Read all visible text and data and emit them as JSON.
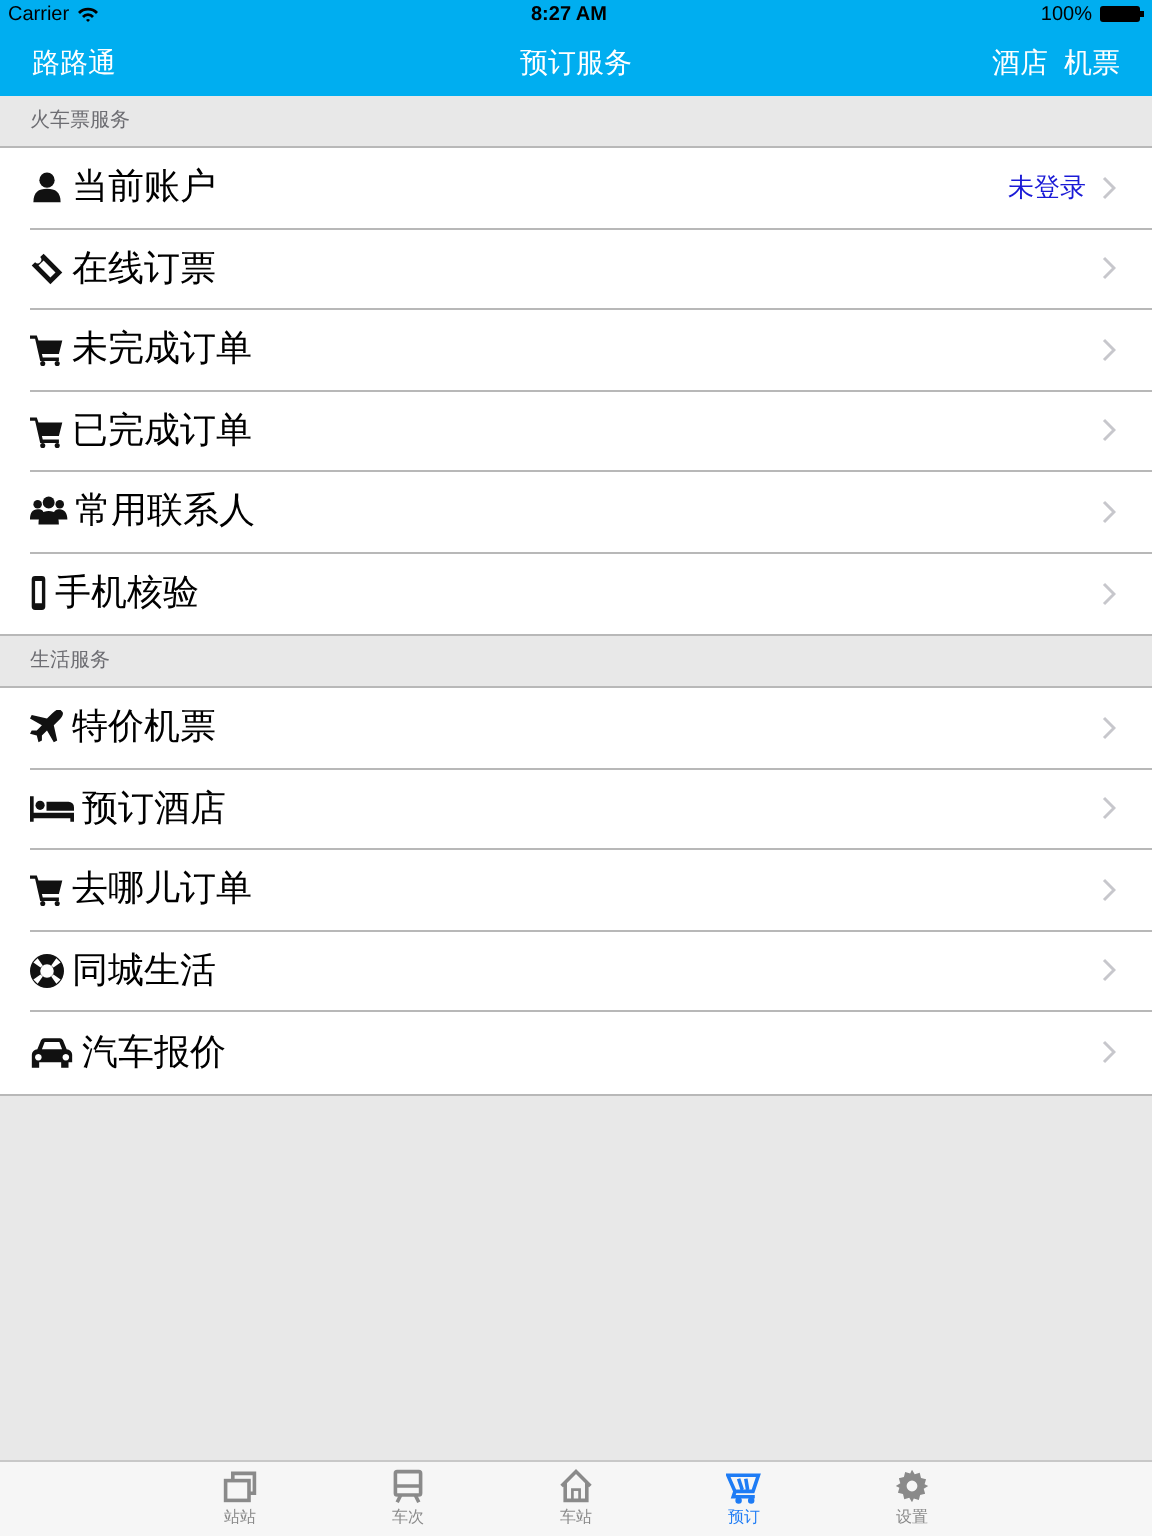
{
  "status_bar": {
    "carrier": "Carrier",
    "time": "8:27 AM",
    "battery": "100%"
  },
  "nav_bar": {
    "left": "路路通",
    "title": "预订服务",
    "right": [
      "酒店",
      "机票"
    ]
  },
  "sections": [
    {
      "header": "火车票服务",
      "rows": [
        {
          "kind": "user",
          "label": "当前账户",
          "detail": "未登录"
        },
        {
          "kind": "ticket",
          "label": "在线订票"
        },
        {
          "kind": "cart",
          "label": "未完成订单"
        },
        {
          "kind": "cart",
          "label": "已完成订单"
        },
        {
          "kind": "users",
          "label": "常用联系人"
        },
        {
          "kind": "phone",
          "label": "手机核验"
        }
      ]
    },
    {
      "header": "生活服务",
      "rows": [
        {
          "kind": "plane",
          "label": "特价机票"
        },
        {
          "kind": "bed",
          "label": "预订酒店"
        },
        {
          "kind": "cart",
          "label": "去哪儿订单"
        },
        {
          "kind": "lifebuoy",
          "label": "同城生活"
        },
        {
          "kind": "car",
          "label": "汽车报价"
        }
      ]
    }
  ],
  "tab_bar": [
    {
      "kind": "windows",
      "label": "站站",
      "selected": false
    },
    {
      "kind": "bus",
      "label": "车次",
      "selected": false
    },
    {
      "kind": "home",
      "label": "车站",
      "selected": false
    },
    {
      "kind": "cart",
      "label": "预订",
      "selected": true
    },
    {
      "kind": "gear",
      "label": "设置",
      "selected": false
    }
  ]
}
